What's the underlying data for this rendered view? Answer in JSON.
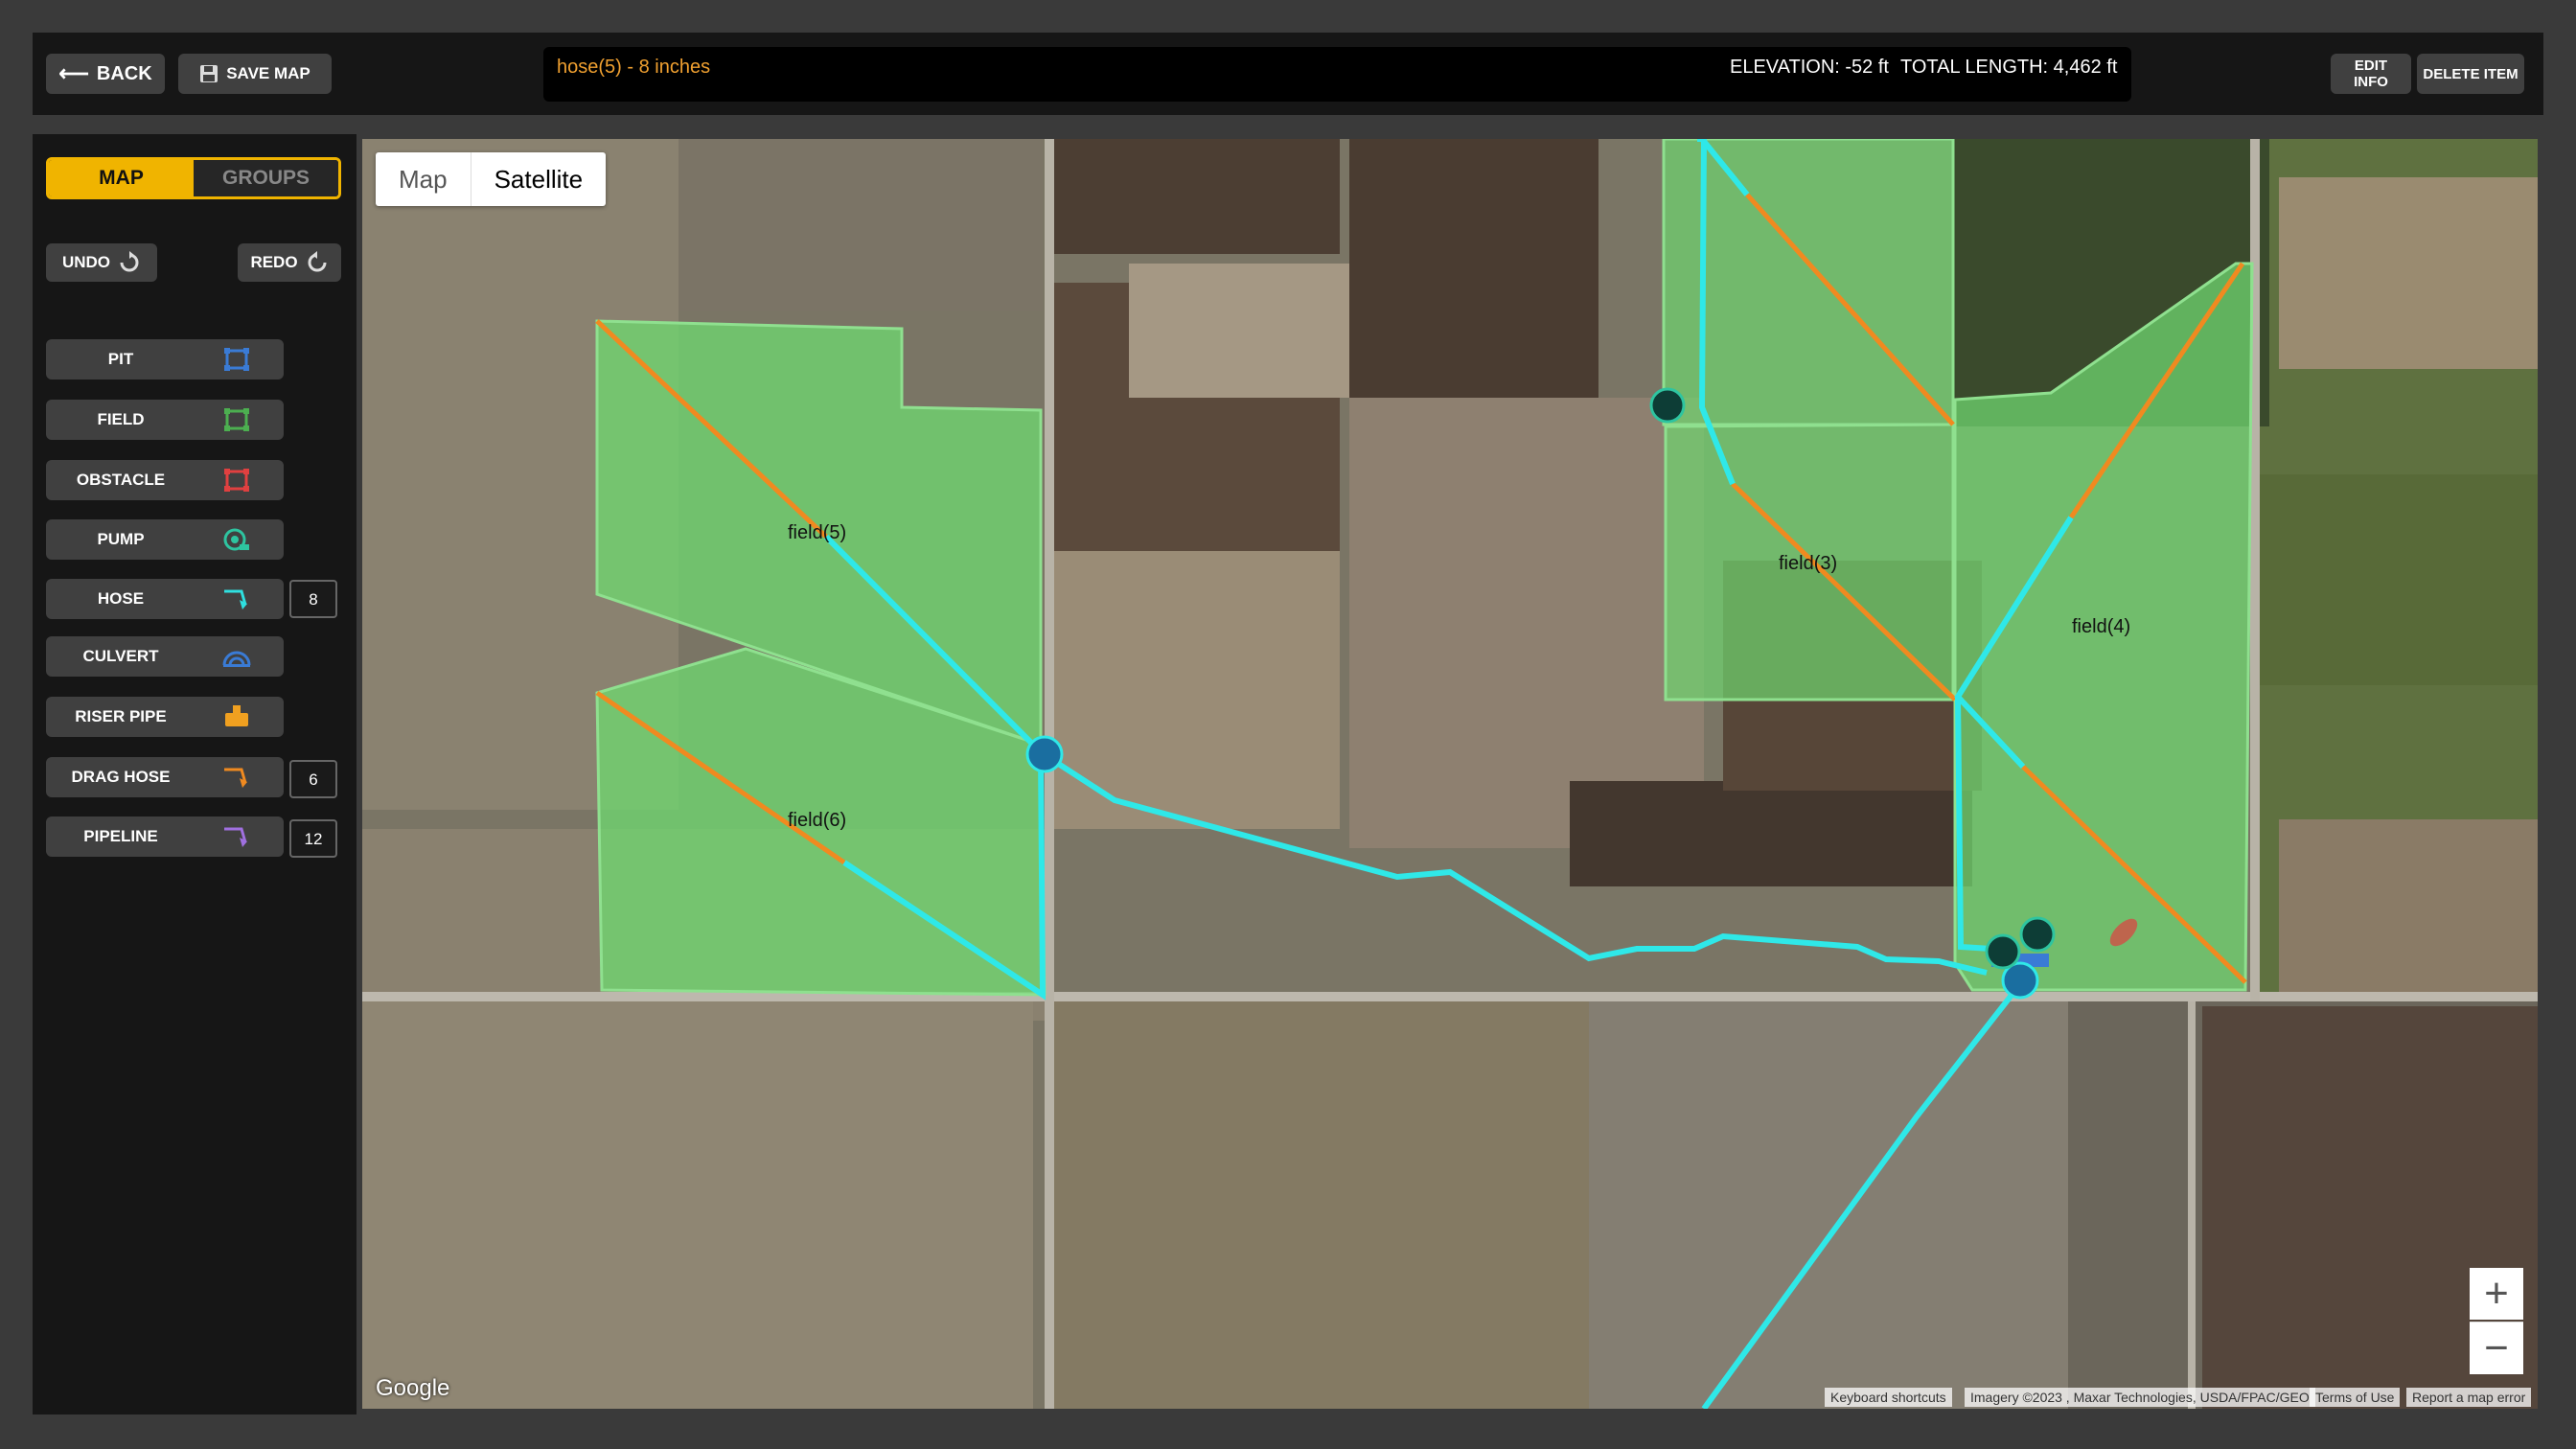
{
  "header": {
    "back_label": "BACK",
    "save_label": "SAVE MAP",
    "selected_item": "hose(5) - 8 inches",
    "elevation": "ELEVATION: -52 ft",
    "total_length": "TOTAL LENGTH: 4,462 ft",
    "edit_label": "EDIT INFO",
    "delete_label": "DELETE ITEM"
  },
  "sidebar": {
    "tabs": [
      "MAP",
      "GROUPS"
    ],
    "active_tab": "MAP",
    "undo_label": "UNDO",
    "redo_label": "REDO",
    "tools": [
      {
        "label": "PIT",
        "icon": "pit-icon",
        "color": "#3a7bd5"
      },
      {
        "label": "FIELD",
        "icon": "field-icon",
        "color": "#4caf50"
      },
      {
        "label": "OBSTACLE",
        "icon": "obstacle-icon",
        "color": "#e04040"
      },
      {
        "label": "PUMP",
        "icon": "pump-icon",
        "color": "#2ec4a0"
      },
      {
        "label": "HOSE",
        "icon": "hose-icon",
        "color": "#2fe0e0",
        "size": "8"
      },
      {
        "label": "CULVERT",
        "icon": "culvert-icon",
        "color": "#3a7bd5"
      },
      {
        "label": "RISER PIPE",
        "icon": "riser-pipe-icon",
        "color": "#f0a020"
      },
      {
        "label": "DRAG HOSE",
        "icon": "drag-hose-icon",
        "color": "#f08a20",
        "size": "6"
      },
      {
        "label": "PIPELINE",
        "icon": "pipeline-icon",
        "color": "#a070e0",
        "size": "12"
      }
    ]
  },
  "map": {
    "type_options": [
      "Map",
      "Satellite"
    ],
    "active_type": "Satellite",
    "fields": [
      "field(5)",
      "field(6)",
      "field(3)",
      "field(4)"
    ],
    "brand": "Google",
    "attribution": [
      "Keyboard shortcuts",
      "Imagery ©2023 , Maxar Technologies, USDA/FPAC/GEO",
      "Terms of Use",
      "Report a map error"
    ],
    "zoom_in": "+",
    "zoom_out": "−"
  },
  "colors": {
    "accent": "#f0b400",
    "hose": "#2fe8e8",
    "drag_hose": "#f08a20",
    "field_fill": "#6fd56f"
  }
}
